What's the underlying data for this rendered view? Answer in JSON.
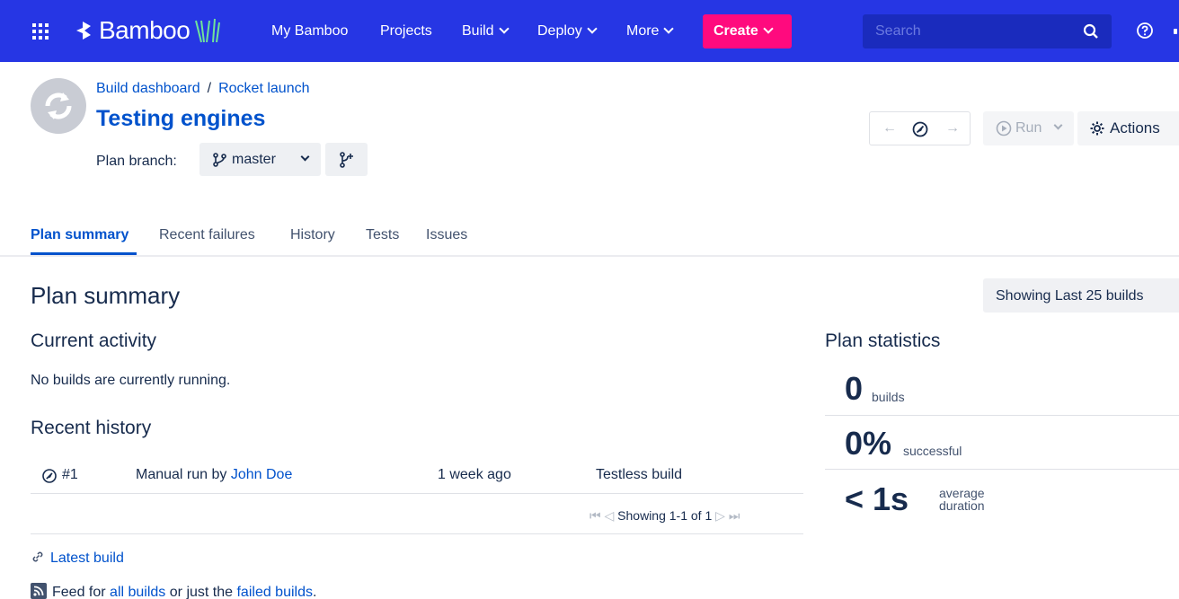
{
  "topbar": {
    "brand": "Bamboo",
    "nav": [
      {
        "label": "My Bamboo"
      },
      {
        "label": "Projects"
      },
      {
        "label": "Build"
      },
      {
        "label": "Deploy"
      },
      {
        "label": "More"
      }
    ],
    "create_label": "Create",
    "search_placeholder": "Search"
  },
  "header": {
    "breadcrumb": {
      "first": "Build dashboard",
      "separator": "/",
      "second": "Rocket launch"
    },
    "title": "Testing engines",
    "branch_label": "Plan branch:",
    "branch_value": "master",
    "run_label": "Run",
    "actions_label": "Actions"
  },
  "tabs": [
    {
      "label": "Plan summary"
    },
    {
      "label": "Recent failures"
    },
    {
      "label": "History"
    },
    {
      "label": "Tests"
    },
    {
      "label": "Issues"
    }
  ],
  "summary": {
    "title": "Plan summary",
    "showing_label": "Showing Last 25 builds",
    "current_activity": {
      "title": "Current activity",
      "text": "No builds are currently running."
    },
    "recent_history": {
      "title": "Recent history",
      "rows": [
        {
          "number": "#1",
          "reason_prefix": "Manual run by",
          "user": "John Doe",
          "time": "1 week ago",
          "tests": "Testless build"
        }
      ],
      "pager_text": "Showing 1-1 of 1"
    },
    "latest_build_label": "Latest build",
    "feed": {
      "prefix": "Feed for",
      "all_link": "all builds",
      "middle": "or just the",
      "failed_link": "failed builds",
      "suffix": "."
    }
  },
  "stats": {
    "title": "Plan statistics",
    "builds_value": "0",
    "builds_label": "builds",
    "success_value": "0%",
    "success_label": "successful",
    "duration_value": "< 1s",
    "duration_label_1": "average",
    "duration_label_2": "duration"
  },
  "colors": {
    "topbar": "#2636e4",
    "create": "#ff0a7e",
    "link": "#0052cc"
  }
}
